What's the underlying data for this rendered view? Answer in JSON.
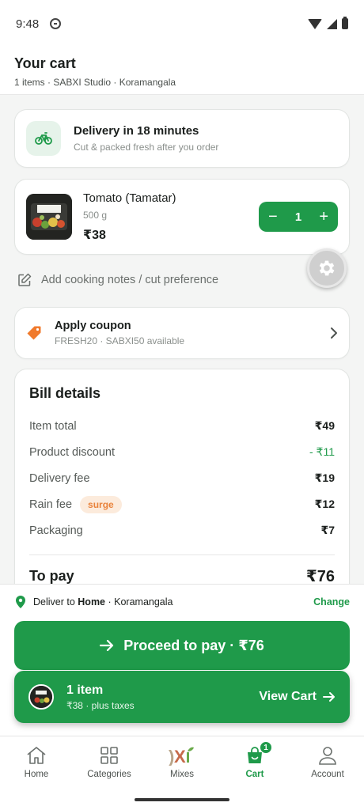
{
  "status_bar": {
    "time": "9:48"
  },
  "header": {
    "title": "Your cart",
    "subtitle": "1 items · SABXI Studio · Koramangala"
  },
  "delivery": {
    "title": "Delivery in 18 minutes",
    "subtitle": "Cut & packed fresh after you order",
    "icon": "bicycle-icon"
  },
  "cart_item": {
    "name": "Tomato (Tamatar)",
    "quantity_label": "500 g",
    "price": "₹38",
    "quantity": "1",
    "decrement_label": "−",
    "increment_label": "+"
  },
  "cooking_notes": {
    "label": "Add cooking notes / cut preference"
  },
  "coupon": {
    "title": "Apply coupon",
    "subtitle": "FRESH20 · SABXI50 available"
  },
  "bill": {
    "title": "Bill details",
    "rows": [
      {
        "label": "Item total",
        "value": "₹49"
      },
      {
        "label": "Product discount",
        "value": "- ₹11"
      },
      {
        "label": "Delivery fee",
        "value": "₹19"
      },
      {
        "label": "Rain fee",
        "value": "₹12",
        "badge": "surge"
      },
      {
        "label": "Packaging",
        "value": "₹7"
      }
    ],
    "to_pay_label": "To pay",
    "to_pay_value": "₹76"
  },
  "deliver_to": {
    "prefix": "Deliver to ",
    "place": "Home",
    "suffix": " · Koramangala",
    "change_label": "Change"
  },
  "proceed": {
    "label": "Proceed to pay · ₹76"
  },
  "cart_bar": {
    "count": "1 item",
    "price": "₹38 · plus taxes",
    "action": "View Cart"
  },
  "nav": {
    "items": [
      {
        "label": "Home",
        "icon": "home-icon"
      },
      {
        "label": "Categories",
        "icon": "grid-icon"
      },
      {
        "label": "Mixes",
        "icon": "mixes-icon"
      },
      {
        "label": "Cart",
        "icon": "cart-icon",
        "badge": "1",
        "active": true
      },
      {
        "label": "Account",
        "icon": "account-icon"
      }
    ]
  },
  "colors": {
    "brand_green": "#1f9a4a",
    "coupon_orange": "#f07a2c",
    "surge_bg": "#fcebdc",
    "surge_text": "#e9823a"
  }
}
